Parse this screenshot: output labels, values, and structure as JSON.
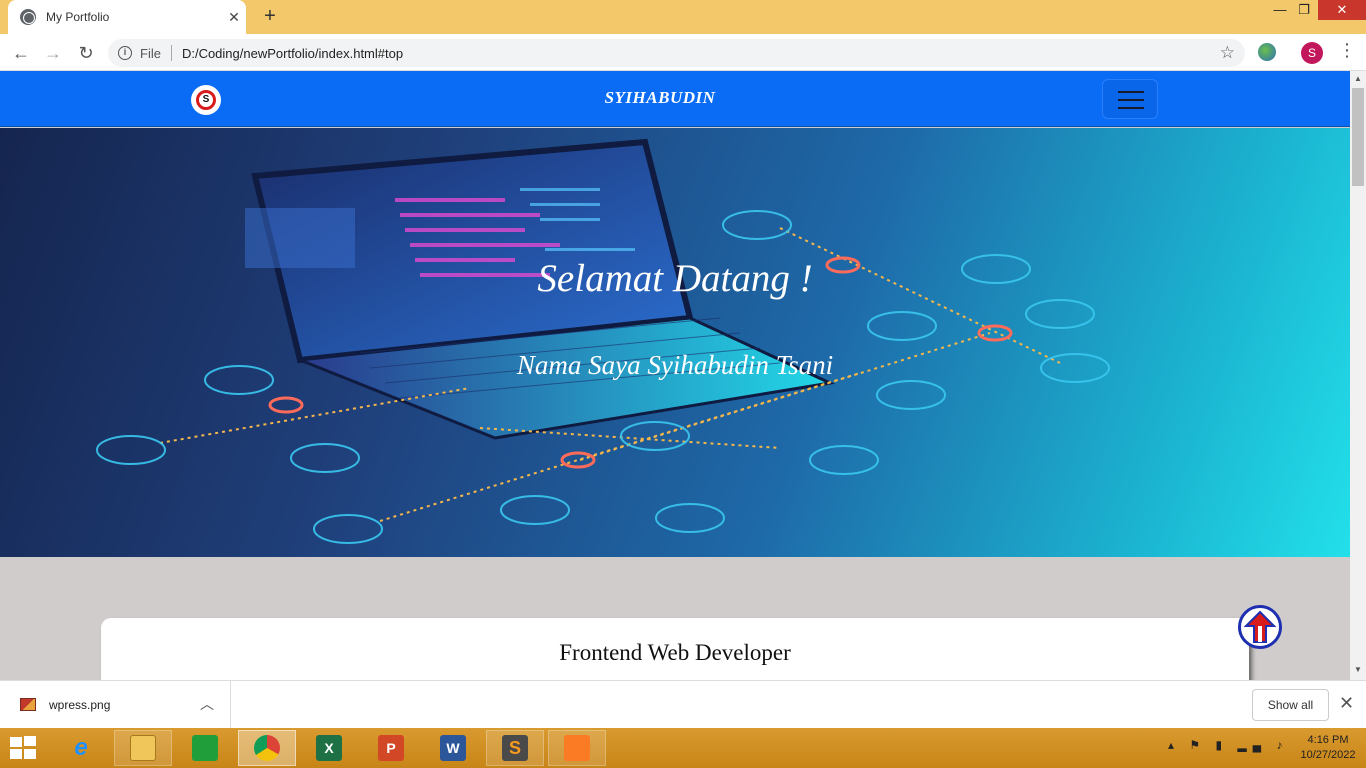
{
  "browser": {
    "tab_title": "My Portfolio",
    "tab_close": "✕",
    "new_tab": "+",
    "scheme_label": "File",
    "url": "D:/Coding/newPortfolio/index.html#top",
    "profile_initial": "S",
    "window_controls": {
      "minimize": "—",
      "maximize": "❐",
      "close": "✕"
    }
  },
  "site": {
    "logo_letter": "S",
    "brand": "SYIHABUDIN",
    "hero_title": "Selamat Datang !",
    "hero_subtitle": "Nama Saya Syihabudin Tsani",
    "card_title": "Frontend Web Developer",
    "colors": {
      "navbar": "#0a6cf5",
      "page_bg": "#d0cccc",
      "hero_start": "#15254f",
      "hero_end": "#22e0ea"
    }
  },
  "downloads": {
    "file_name": "wpress.png",
    "show_all": "Show all"
  },
  "taskbar": {
    "apps": [
      {
        "name": "internet-explorer-icon",
        "label": "e"
      },
      {
        "name": "file-explorer-icon",
        "label": ""
      },
      {
        "name": "store-icon",
        "label": ""
      },
      {
        "name": "chrome-icon",
        "label": ""
      },
      {
        "name": "excel-icon",
        "label": "X"
      },
      {
        "name": "powerpoint-icon",
        "label": "P"
      },
      {
        "name": "word-icon",
        "label": "W"
      },
      {
        "name": "sublime-text-icon",
        "label": "S"
      },
      {
        "name": "xampp-icon",
        "label": ""
      }
    ],
    "time": "4:16 PM",
    "date": "10/27/2022"
  }
}
